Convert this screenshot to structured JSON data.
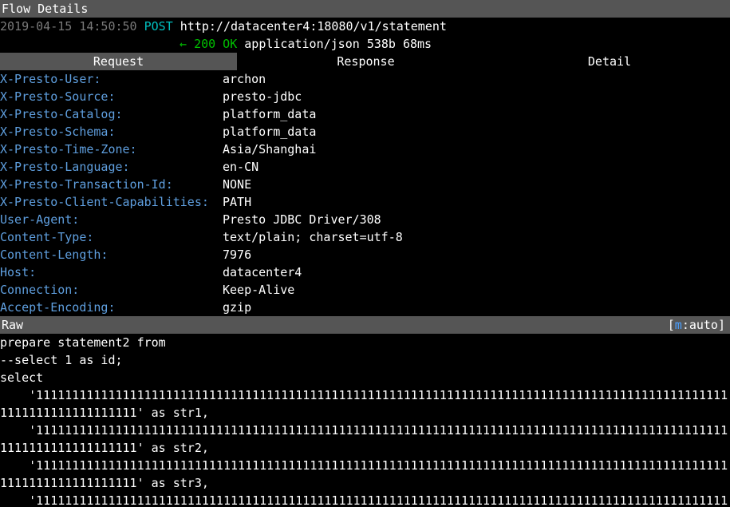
{
  "title_bar": {
    "title": "Flow Details"
  },
  "flow": {
    "timestamp": "2019-04-15 14:50:50",
    "method": "POST",
    "url": "http://datacenter4:18080/v1/statement",
    "arrow": "←",
    "status": "200 OK",
    "content_type": "application/json",
    "size": "538b",
    "duration": "68ms"
  },
  "tabs": [
    {
      "label": "Request",
      "active": true
    },
    {
      "label": "Response",
      "active": false
    },
    {
      "label": "Detail",
      "active": false
    }
  ],
  "headers": [
    {
      "key": "X-Presto-User:",
      "value": "archon"
    },
    {
      "key": "X-Presto-Source:",
      "value": "presto-jdbc"
    },
    {
      "key": "X-Presto-Catalog:",
      "value": "platform_data"
    },
    {
      "key": "X-Presto-Schema:",
      "value": "platform_data"
    },
    {
      "key": "X-Presto-Time-Zone:",
      "value": "Asia/Shanghai"
    },
    {
      "key": "X-Presto-Language:",
      "value": "en-CN"
    },
    {
      "key": "X-Presto-Transaction-Id:",
      "value": "NONE"
    },
    {
      "key": "X-Presto-Client-Capabilities:",
      "value": "PATH"
    },
    {
      "key": "User-Agent:",
      "value": "Presto JDBC Driver/308"
    },
    {
      "key": "Content-Type:",
      "value": "text/plain; charset=utf-8"
    },
    {
      "key": "Content-Length:",
      "value": "7976"
    },
    {
      "key": "Host:",
      "value": "datacenter4"
    },
    {
      "key": "Connection:",
      "value": "Keep-Alive"
    },
    {
      "key": "Accept-Encoding:",
      "value": "gzip"
    }
  ],
  "raw_bar": {
    "label": "Raw",
    "mode_open": "[",
    "mode_key": "m",
    "mode_rest": ":auto]"
  },
  "body_lines": [
    "prepare statement2 from",
    "--select 1 as id;",
    "select",
    "    '111111111111111111111111111111111111111111111111111111111111111111111111111111111111111111111111",
    "1111111111111111111' as str1,",
    "    '111111111111111111111111111111111111111111111111111111111111111111111111111111111111111111111111",
    "1111111111111111111' as str2,",
    "    '111111111111111111111111111111111111111111111111111111111111111111111111111111111111111111111111",
    "1111111111111111111' as str3,",
    "    '111111111111111111111111111111111111111111111111111111111111111111111111111111111111111111111111"
  ]
}
